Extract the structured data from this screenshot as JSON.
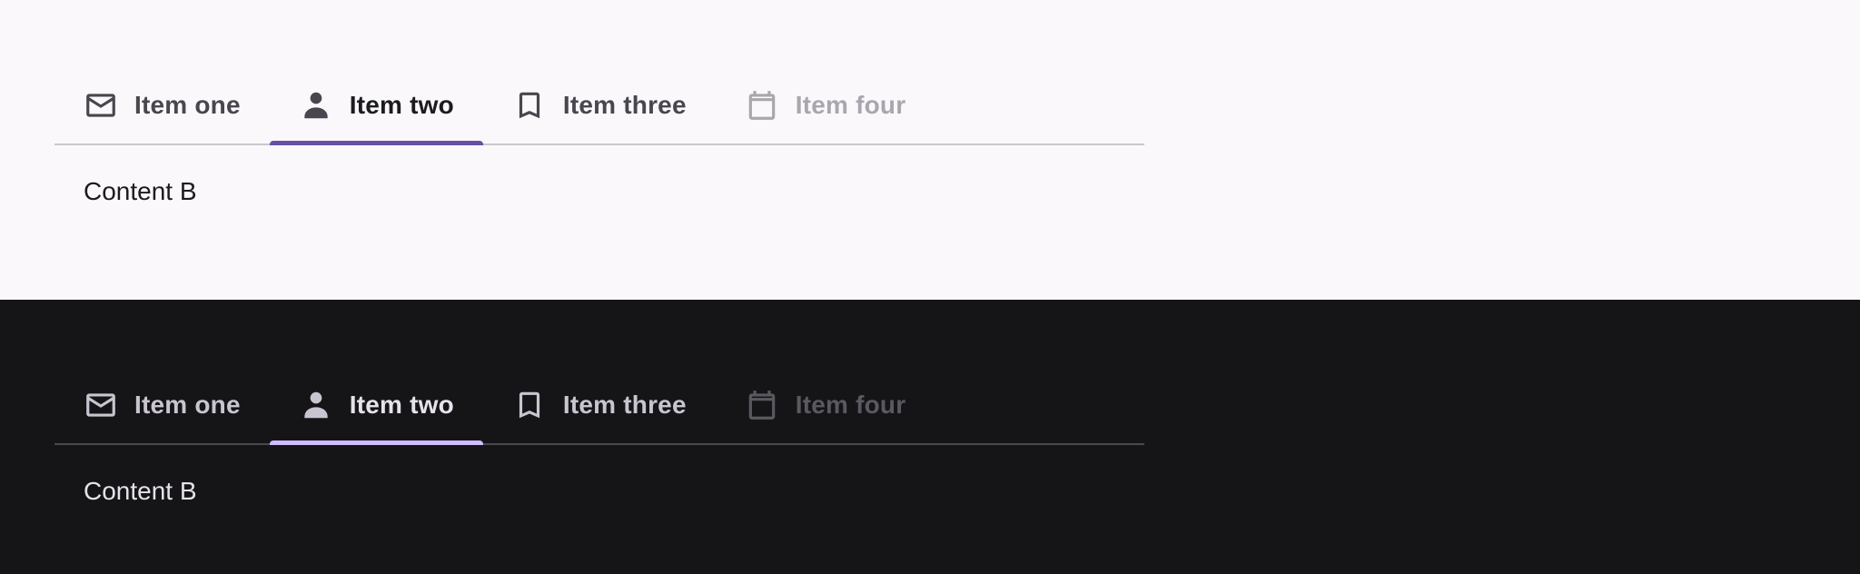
{
  "colors": {
    "light_background": "#faf8fb",
    "dark_background": "#151518",
    "light_indicator": "#6750a4",
    "dark_indicator": "#d0bcff"
  },
  "light": {
    "tabs": [
      {
        "label": "Item one",
        "icon": "mail-icon",
        "state": "normal"
      },
      {
        "label": "Item two",
        "icon": "person-icon",
        "state": "active"
      },
      {
        "label": "Item three",
        "icon": "bookmark-icon",
        "state": "normal"
      },
      {
        "label": "Item four",
        "icon": "calendar-icon",
        "state": "disabled"
      }
    ],
    "content": "Content B"
  },
  "dark": {
    "tabs": [
      {
        "label": "Item one",
        "icon": "mail-icon",
        "state": "normal"
      },
      {
        "label": "Item two",
        "icon": "person-icon",
        "state": "active"
      },
      {
        "label": "Item three",
        "icon": "bookmark-icon",
        "state": "normal"
      },
      {
        "label": "Item four",
        "icon": "calendar-icon",
        "state": "disabled"
      }
    ],
    "content": "Content B"
  }
}
